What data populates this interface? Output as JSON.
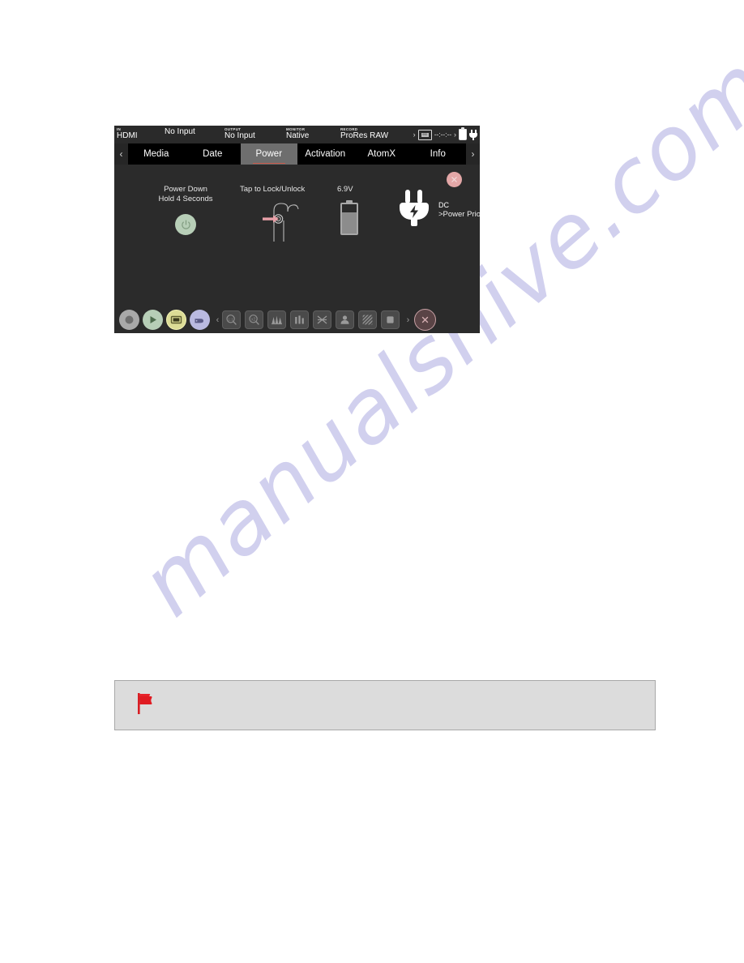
{
  "watermark": {
    "text": "manualshive.com"
  },
  "device": {
    "status_bar": {
      "input": {
        "tiny": "IN",
        "value": "HDMI"
      },
      "input_signal": {
        "tiny": "",
        "value": "No Input"
      },
      "output": {
        "tiny": "OUTPUT",
        "value": "No Input"
      },
      "monitor": {
        "tiny": "MONITOR",
        "value": "Native"
      },
      "record": {
        "tiny": "RECORD",
        "value": "ProRes RAW"
      },
      "left_chevron": "›",
      "right_chevron": "›",
      "media_icon_label": "SSD",
      "timecode": "--:--:--",
      "battery_icon": "battery-icon",
      "power_icon": "plug-icon"
    },
    "tab_bar": {
      "prev_arrow": "‹",
      "next_arrow": "›",
      "tabs": [
        {
          "label": "Media",
          "active": false
        },
        {
          "label": "Date",
          "active": false
        },
        {
          "label": "Power",
          "active": true
        },
        {
          "label": "Activation",
          "active": false
        },
        {
          "label": "AtomX",
          "active": false
        },
        {
          "label": "Info",
          "active": false
        }
      ],
      "active_underline_color": "#c8584a"
    },
    "content": {
      "close_button": "close-icon",
      "power_down": {
        "line1": "Power Down",
        "line2": "Hold 4 Seconds",
        "button_icon": "power-icon",
        "button_color": "#b7ceb7"
      },
      "lock": {
        "label": "Tap to Lock/Unlock",
        "icon": "padlock-icon",
        "pointer_color": "#e8a0a8"
      },
      "battery": {
        "voltage": "6.9V",
        "icon": "battery-icon",
        "fill_percent": 72
      },
      "dc": {
        "icon": "plug-icon",
        "title": "DC",
        "subtitle": ">Power Priority Mode"
      }
    },
    "toolbar": {
      "round_buttons": [
        {
          "name": "record-button",
          "icon": "record-icon",
          "color": "#a9a9a9"
        },
        {
          "name": "play-button",
          "icon": "play-icon",
          "color": "#b7ceb7"
        },
        {
          "name": "monitor-button",
          "icon": "monitor-icon",
          "color": "#dcdc96"
        },
        {
          "name": "tag-button",
          "icon": "tag-icon",
          "color": "#b9b9e0"
        }
      ],
      "prev_arrow": "‹",
      "next_arrow": "›",
      "tool_buttons": [
        {
          "name": "zoom-1to1-button",
          "icon": "magnifier-1to1-icon"
        },
        {
          "name": "zoom-2x-button",
          "icon": "magnifier-2x-icon"
        },
        {
          "name": "waveform-button",
          "icon": "waveform-icon"
        },
        {
          "name": "rgb-parade-button",
          "icon": "rgb-parade-icon"
        },
        {
          "name": "vectorscope-button",
          "icon": "vectorscope-icon"
        },
        {
          "name": "focus-peaking-button",
          "icon": "person-icon"
        },
        {
          "name": "zebra-button",
          "icon": "zebra-icon"
        },
        {
          "name": "false-color-button",
          "icon": "false-color-icon"
        }
      ],
      "close_button": "close-icon"
    }
  },
  "note": {
    "flag_icon": "red-flag-icon",
    "flag_glyph": "⚑",
    "text": ""
  }
}
